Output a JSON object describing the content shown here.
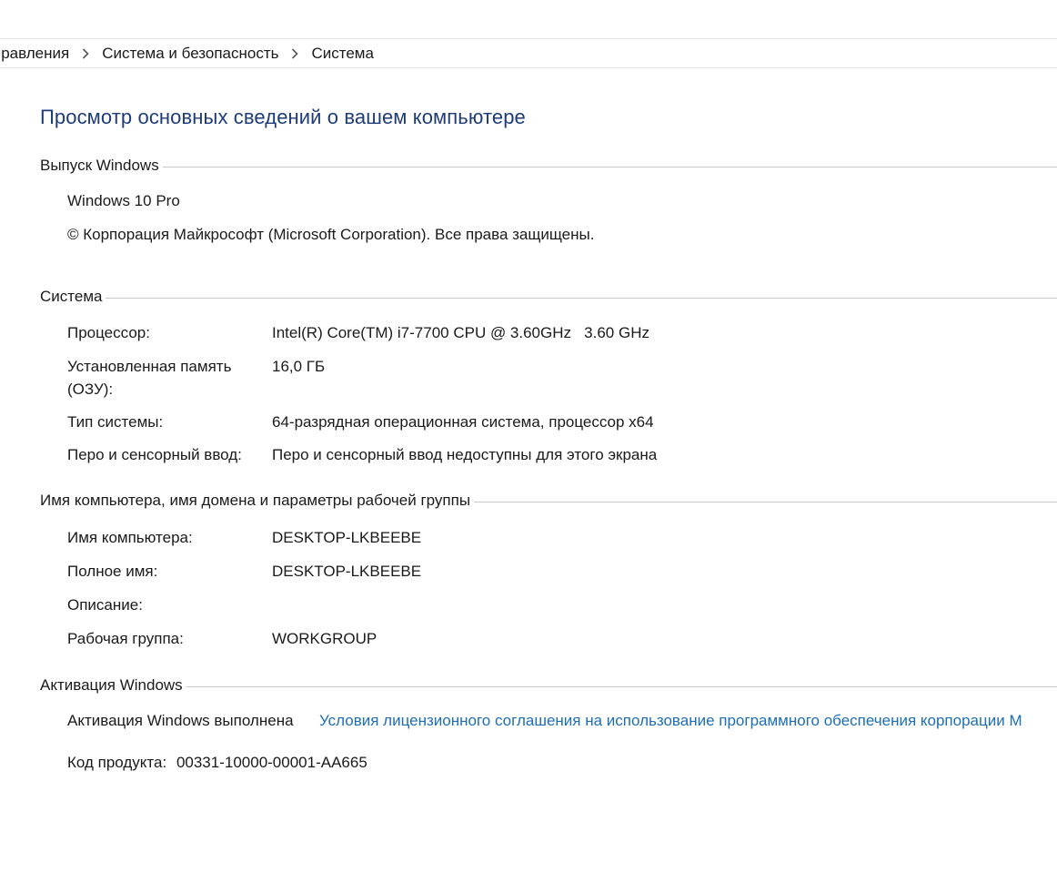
{
  "breadcrumb": {
    "items": [
      {
        "label": "правления"
      },
      {
        "label": "Система и безопасность"
      },
      {
        "label": "Система"
      }
    ]
  },
  "title": "Просмотр основных сведений о вашем компьютере",
  "edition": {
    "heading": "Выпуск Windows",
    "name": "Windows 10 Pro",
    "copyright": "© Корпорация Майкрософт (Microsoft Corporation). Все права защищены."
  },
  "system": {
    "heading": "Система",
    "processor": {
      "label": "Процессор:",
      "value": "Intel(R) Core(TM) i7-7700 CPU @ 3.60GHz   3.60 GHz"
    },
    "memory": {
      "label_line1": "Установленная память",
      "label_line2": "(ОЗУ):",
      "value": "16,0 ГБ"
    },
    "type": {
      "label": "Тип системы:",
      "value": "64-разрядная операционная система, процессор x64"
    },
    "pen": {
      "label": "Перо и сенсорный ввод:",
      "value": "Перо и сенсорный ввод недоступны для этого экрана"
    }
  },
  "computer": {
    "heading": "Имя компьютера, имя домена и параметры рабочей группы",
    "name": {
      "label": "Имя компьютера:",
      "value": "DESKTOP-LKBEEBE"
    },
    "full_name": {
      "label": "Полное имя:",
      "value": "DESKTOP-LKBEEBE"
    },
    "description": {
      "label": "Описание:",
      "value": ""
    },
    "workgroup": {
      "label": "Рабочая группа:",
      "value": "WORKGROUP"
    }
  },
  "activation": {
    "heading": "Активация Windows",
    "status": "Активация Windows выполнена",
    "license_link": "Условия лицензионного соглашения на использование программного обеспечения корпорации М",
    "product_key_label": "Код продукта:",
    "product_key": "00331-10000-00001-AA665"
  },
  "colors": {
    "title": "#1e3c78",
    "link": "#1e6eb4",
    "divider": "#c8c8c8"
  }
}
